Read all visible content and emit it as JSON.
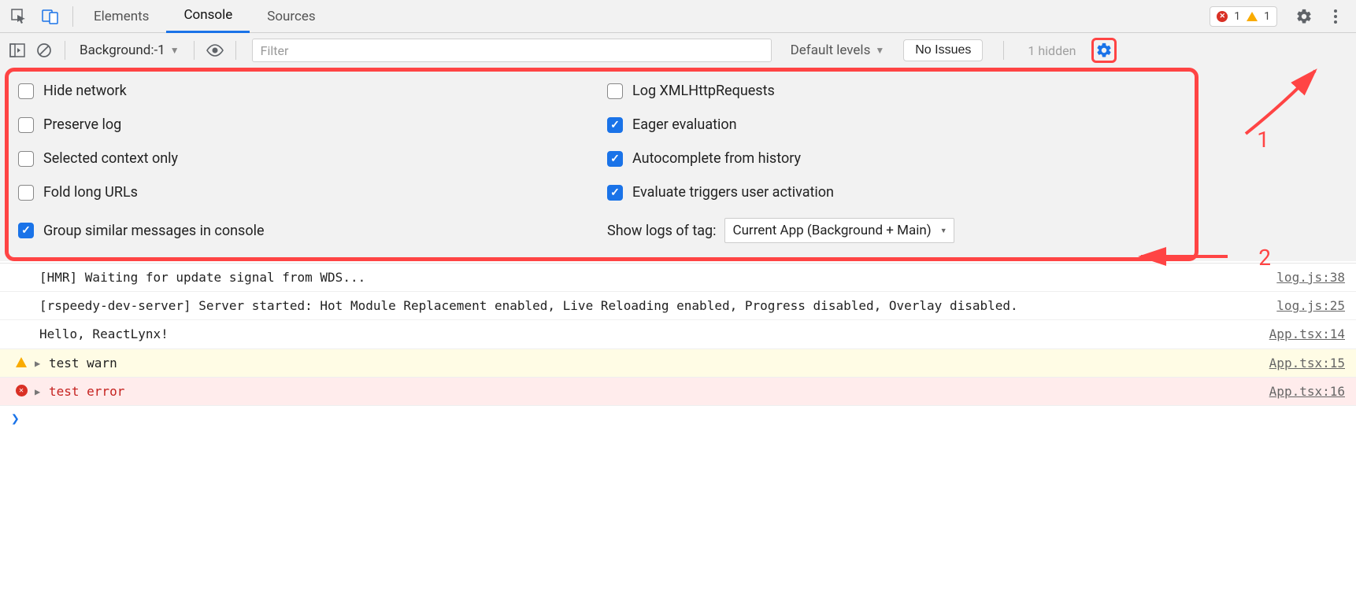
{
  "tabs": {
    "elements": "Elements",
    "console": "Console",
    "sources": "Sources"
  },
  "status": {
    "error_count": "1",
    "warn_count": "1"
  },
  "toolbar": {
    "context": "Background:-1",
    "filter_placeholder": "Filter",
    "levels": "Default levels",
    "issues": "No Issues",
    "hidden": "1 hidden"
  },
  "settings": {
    "left": [
      {
        "label": "Hide network",
        "checked": false
      },
      {
        "label": "Preserve log",
        "checked": false
      },
      {
        "label": "Selected context only",
        "checked": false
      },
      {
        "label": "Fold long URLs",
        "checked": false
      },
      {
        "label": "Group similar messages in console",
        "checked": true
      }
    ],
    "right": [
      {
        "label": "Log XMLHttpRequests",
        "checked": false
      },
      {
        "label": "Eager evaluation",
        "checked": true
      },
      {
        "label": "Autocomplete from history",
        "checked": true
      },
      {
        "label": "Evaluate triggers user activation",
        "checked": true
      }
    ],
    "tag_label": "Show logs of tag:",
    "tag_value": "Current App (Background + Main)"
  },
  "annotations": {
    "one": "1",
    "two": "2"
  },
  "logs": [
    {
      "type": "log",
      "msg": "[HMR] Waiting for update signal from WDS...",
      "src": "log.js:38"
    },
    {
      "type": "log",
      "msg": "[rspeedy-dev-server] Server started: Hot Module Replacement enabled, Live Reloading enabled, Progress disabled, Overlay disabled.",
      "src": "log.js:25"
    },
    {
      "type": "log",
      "msg": "Hello, ReactLynx!",
      "src": "App.tsx:14"
    },
    {
      "type": "warn",
      "msg": "test warn",
      "src": "App.tsx:15"
    },
    {
      "type": "error",
      "msg": "test error",
      "src": "App.tsx:16"
    }
  ],
  "prompt": ">"
}
